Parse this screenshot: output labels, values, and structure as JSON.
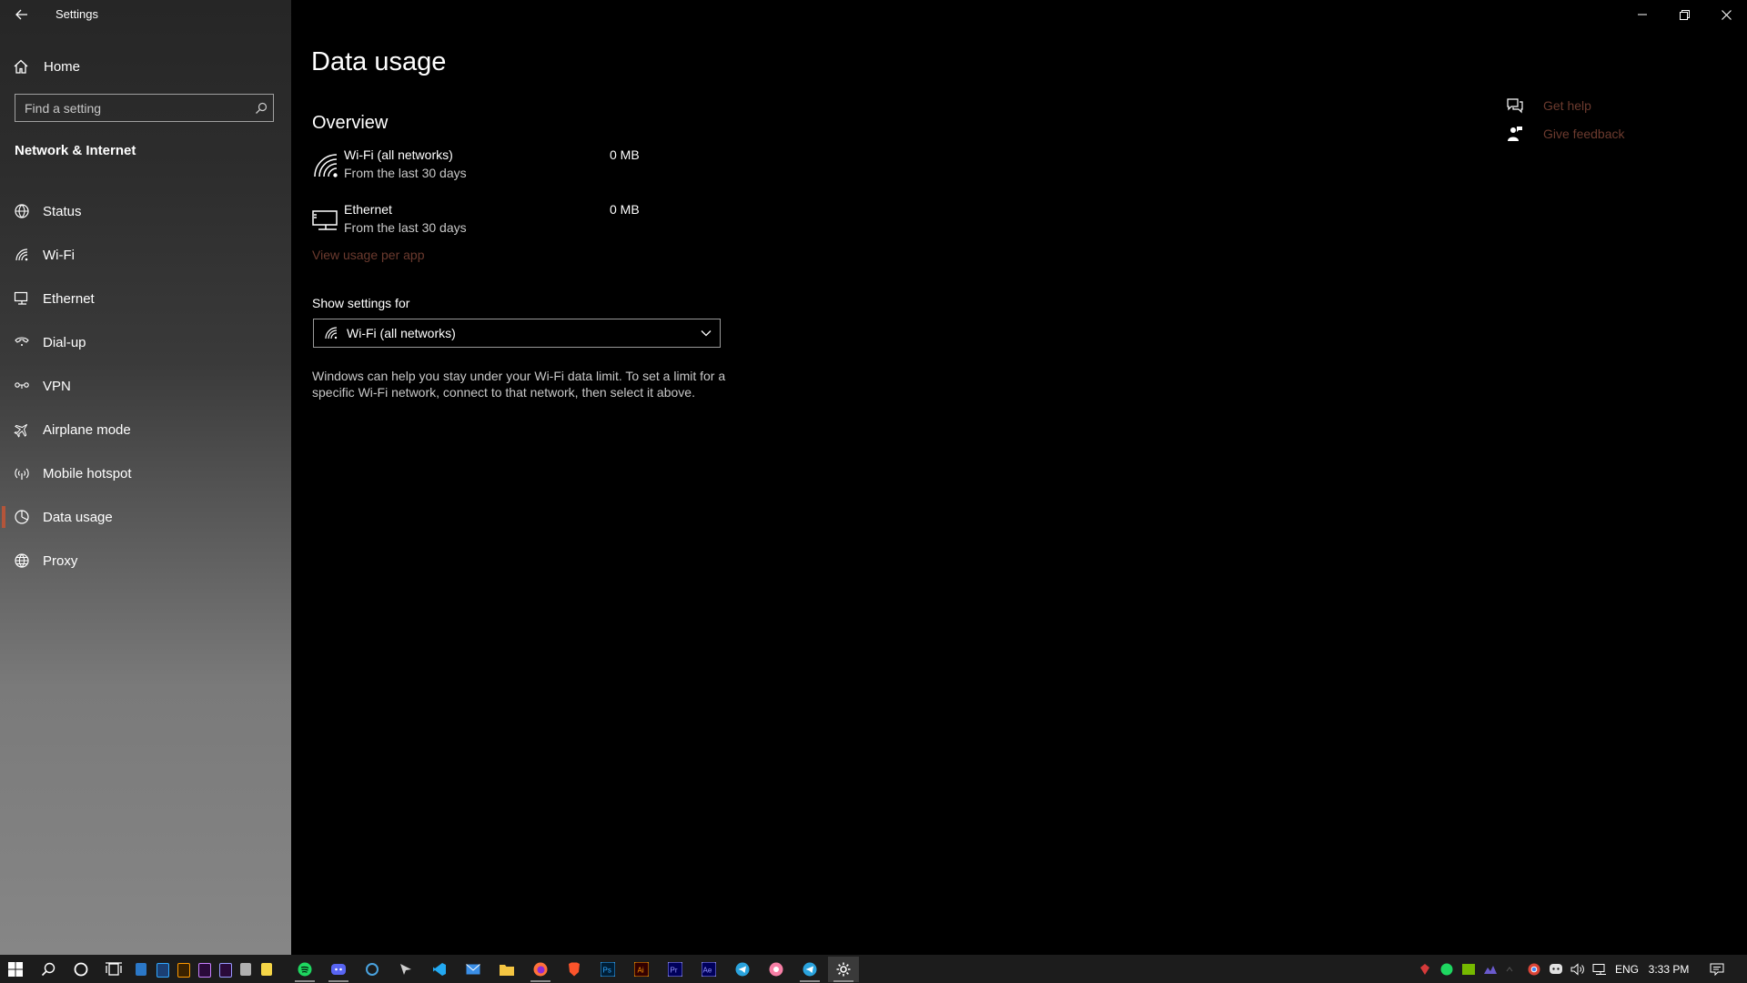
{
  "window": {
    "title": "Settings"
  },
  "sidebar": {
    "home_label": "Home",
    "search_placeholder": "Find a setting",
    "section_title": "Network & Internet",
    "items": [
      {
        "label": "Status",
        "icon": "globe-status-icon"
      },
      {
        "label": "Wi-Fi",
        "icon": "wifi-icon"
      },
      {
        "label": "Ethernet",
        "icon": "ethernet-icon"
      },
      {
        "label": "Dial-up",
        "icon": "dialup-icon"
      },
      {
        "label": "VPN",
        "icon": "vpn-icon"
      },
      {
        "label": "Airplane mode",
        "icon": "airplane-icon"
      },
      {
        "label": "Mobile hotspot",
        "icon": "hotspot-icon"
      },
      {
        "label": "Data usage",
        "icon": "data-usage-icon",
        "selected": true
      },
      {
        "label": "Proxy",
        "icon": "globe-icon"
      }
    ]
  },
  "main": {
    "title": "Data usage",
    "overview_heading": "Overview",
    "usage": [
      {
        "name": "Wi-Fi (all networks)",
        "sub": "From the last 30 days",
        "value": "0 MB"
      },
      {
        "name": "Ethernet",
        "sub": "From the last 30 days",
        "value": "0 MB"
      }
    ],
    "view_usage_link": "View usage per app",
    "show_settings_label": "Show settings for",
    "show_settings_value": "Wi-Fi (all networks)",
    "help_text": "Windows can help you stay under your Wi-Fi data limit. To set a limit for a specific Wi-Fi network, connect to that network, then select it above.",
    "get_help": "Get help",
    "give_feedback": "Give feedback"
  },
  "taskbar": {
    "language": "ENG",
    "time": "3:33 PM"
  },
  "colors": {
    "accent": "#b4553a",
    "link": "#6b3a2e",
    "background": "#000000"
  }
}
